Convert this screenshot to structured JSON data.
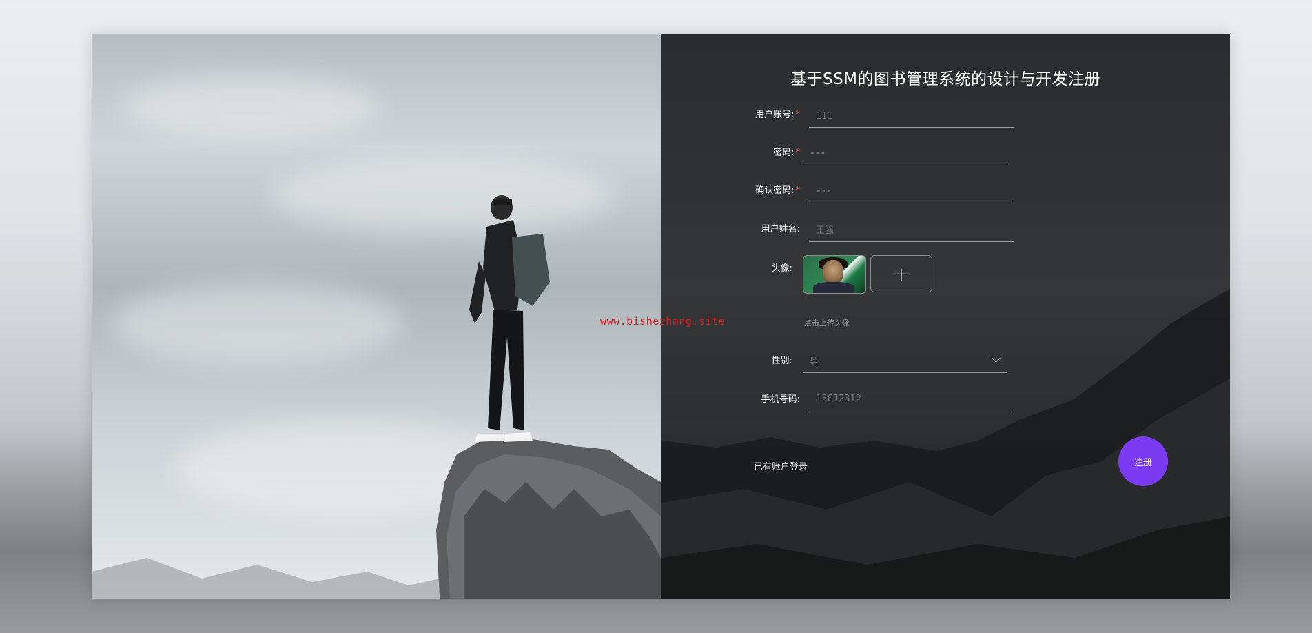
{
  "page": {
    "title": "基于SSM的图书管理系统的设计与开发注册",
    "watermark": "www.bishezhang.site"
  },
  "form": {
    "account": {
      "label": "用户账号:",
      "required_mark": "*",
      "value": "111"
    },
    "password": {
      "label": "密码:",
      "required_mark": "*",
      "value": "•••"
    },
    "confirm_password": {
      "label": "确认密码:",
      "required_mark": "*",
      "value": "•••"
    },
    "username": {
      "label": "用户姓名:",
      "value": "王强"
    },
    "avatar": {
      "label": "头像:",
      "upload_plus": "+",
      "hint": "点击上传头像"
    },
    "gender": {
      "label": "性别:",
      "selected": "男"
    },
    "phone": {
      "label": "手机号码:",
      "value": "13612312"
    }
  },
  "actions": {
    "login_link": "已有账户登录",
    "register_button": "注册"
  },
  "colors": {
    "accent": "#7b3bf2",
    "required": "#e74c3c",
    "watermark": "#e01a1a"
  }
}
